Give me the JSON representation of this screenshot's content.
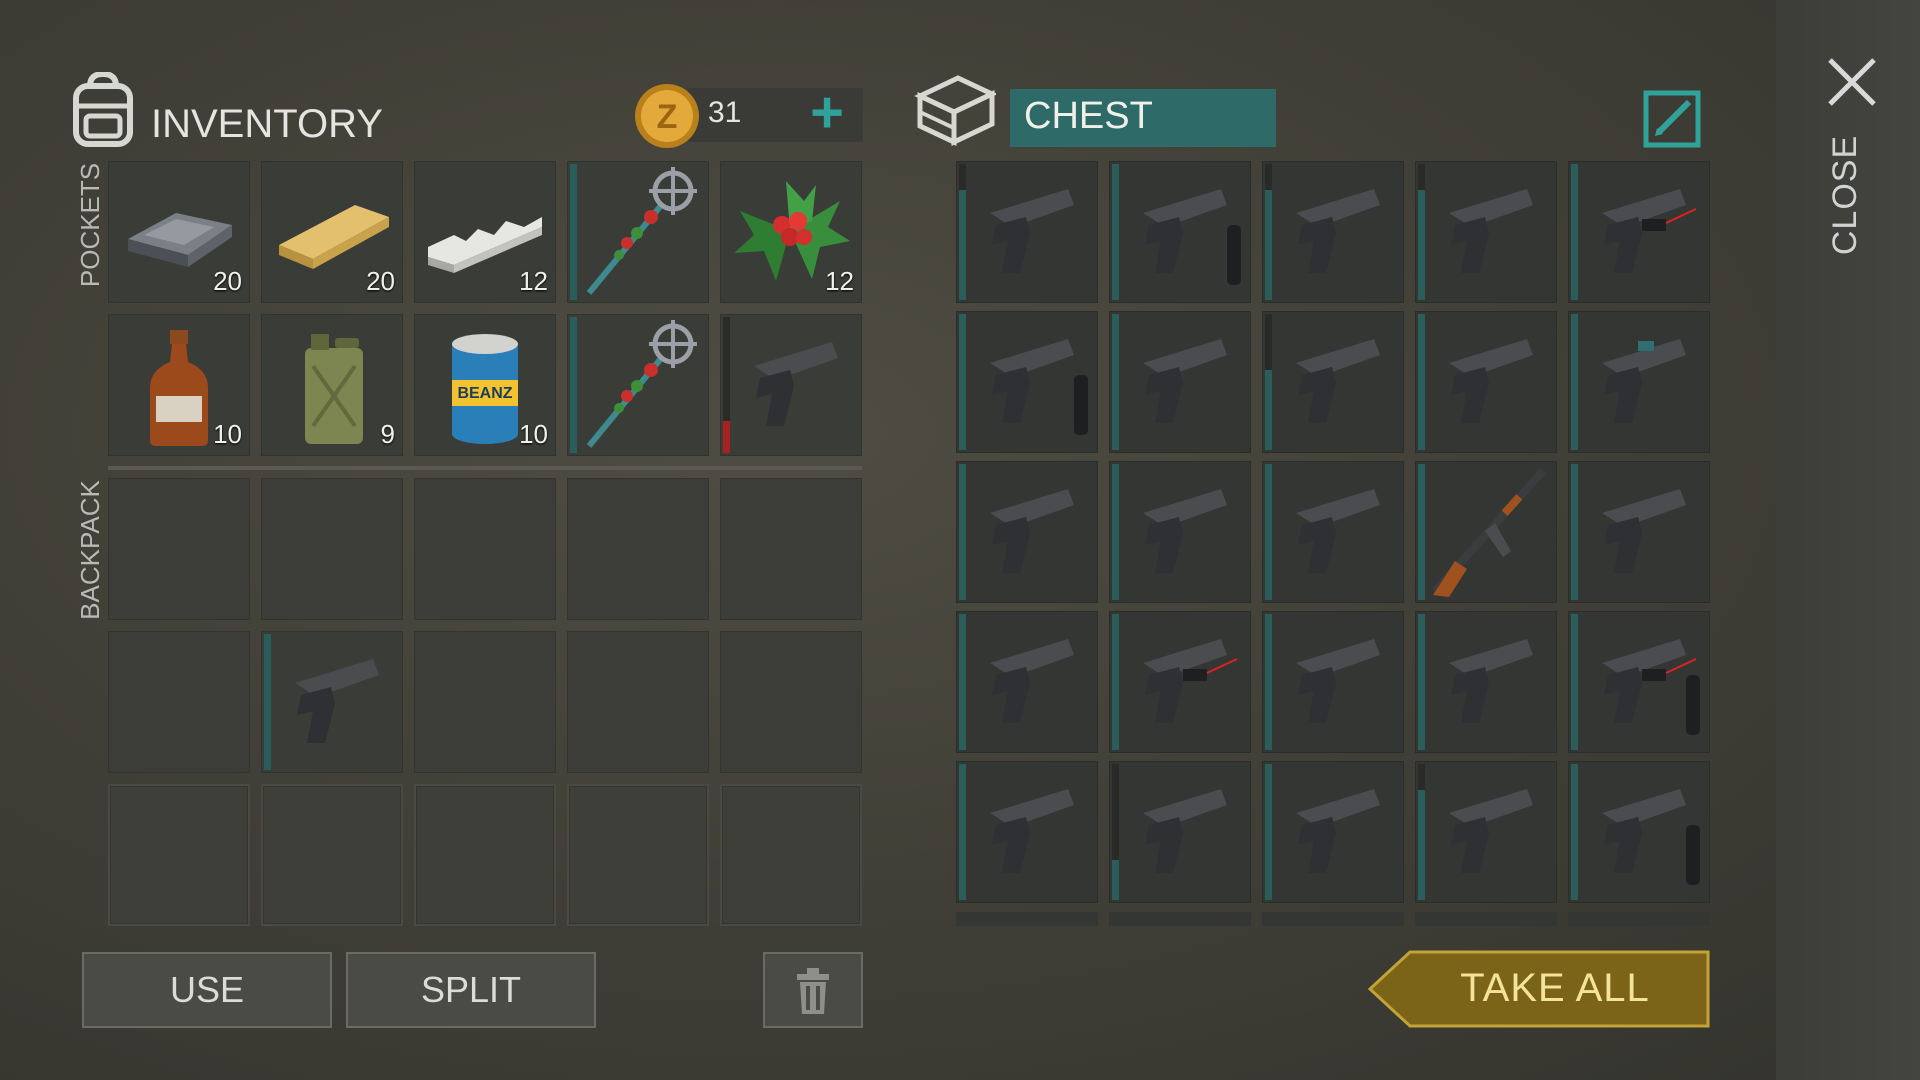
{
  "inventory": {
    "title": "INVENTORY",
    "coins": "31",
    "pockets_label": "POCKETS",
    "backpack_label": "BACKPACK",
    "pockets": [
      {
        "icon": "iron-bar-icon",
        "qty": "20"
      },
      {
        "icon": "wood-plank-icon",
        "qty": "20"
      },
      {
        "icon": "aluminum-bar-icon",
        "qty": "12"
      },
      {
        "icon": "festive-staff-icon",
        "qty": ""
      },
      {
        "icon": "holly-icon",
        "qty": "12"
      },
      {
        "icon": "bottle-icon",
        "qty": "10"
      },
      {
        "icon": "jerrycan-icon",
        "qty": "9"
      },
      {
        "icon": "canned-beans-icon",
        "qty": "10"
      },
      {
        "icon": "festive-staff-icon",
        "qty": ""
      },
      {
        "icon": "pistol-icon",
        "qty": ""
      }
    ],
    "backpack": [
      {
        "icon": ""
      },
      {
        "icon": ""
      },
      {
        "icon": ""
      },
      {
        "icon": ""
      },
      {
        "icon": ""
      },
      {
        "icon": ""
      },
      {
        "icon": "pistol-icon"
      },
      {
        "icon": ""
      },
      {
        "icon": ""
      },
      {
        "icon": ""
      }
    ],
    "buttons": {
      "use": "USE",
      "split": "SPLIT"
    }
  },
  "chest": {
    "title": "CHEST",
    "take_all": "TAKE ALL",
    "items": [
      "pistol-icon",
      "pistol-silencer-icon",
      "pistol-icon",
      "pistol-icon",
      "pistol-laser-icon",
      "pistol-silencer-icon",
      "pistol-icon",
      "pistol-icon",
      "pistol-icon",
      "pistol-scope-icon",
      "pistol-icon",
      "pistol-icon",
      "pistol-icon",
      "assault-rifle-icon",
      "pistol-icon",
      "pistol-icon",
      "pistol-laser-icon",
      "pistol-icon",
      "pistol-icon",
      "pistol-laser-silencer-icon",
      "pistol-icon",
      "pistol-icon",
      "pistol-icon",
      "pistol-icon",
      "pistol-silencer-icon"
    ]
  },
  "close_label": "CLOSE",
  "colors": {
    "accent": "#2fa39a",
    "chest_header": "#2e6a68",
    "take_all": "#8a6f1a",
    "durability_low": "#a82020"
  }
}
